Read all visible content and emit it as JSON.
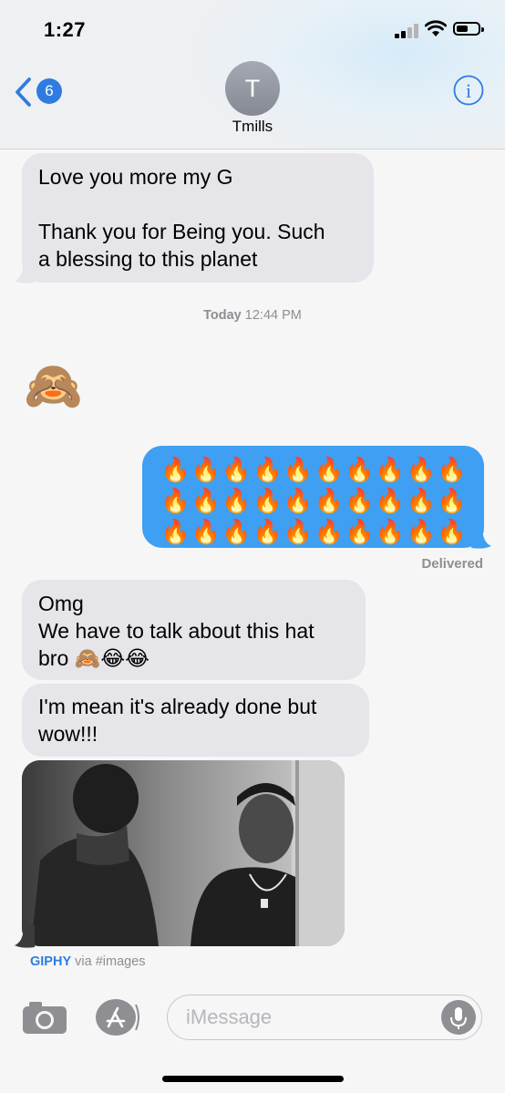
{
  "status_bar": {
    "time": "1:27"
  },
  "nav": {
    "back_count": "6",
    "avatar_initial": "T",
    "contact_name": "Tmills",
    "info_label": "i"
  },
  "messages": {
    "m1_line1": "Love you more my G",
    "m1_line2": "Thank you for Being you. Such",
    "m1_line3": "a blessing to this planet",
    "timestamp_day": "Today",
    "timestamp_time": "12:44 PM",
    "emoji_only": "🙈",
    "outgoing_fire": "🔥",
    "delivered": "Delivered",
    "m3_line1": "Omg",
    "m3_line2": "We have to talk about this hat",
    "m3_line3": "bro 🙈😂😂",
    "m4_line1": "I'm mean it's already done but",
    "m4_line2": "wow!!!",
    "giphy_brand": "GIPHY",
    "giphy_via": "via #images"
  },
  "composer": {
    "placeholder": "iMessage"
  },
  "icons": [
    "back-chevron-icon",
    "info-icon",
    "camera-icon",
    "app-store-icon",
    "microphone-icon",
    "wifi-icon",
    "battery-icon",
    "signal-icon"
  ],
  "colors": {
    "accent": "#2f7ce0",
    "outgoing": "#3f9ff2",
    "incoming": "#e5e5ea"
  }
}
